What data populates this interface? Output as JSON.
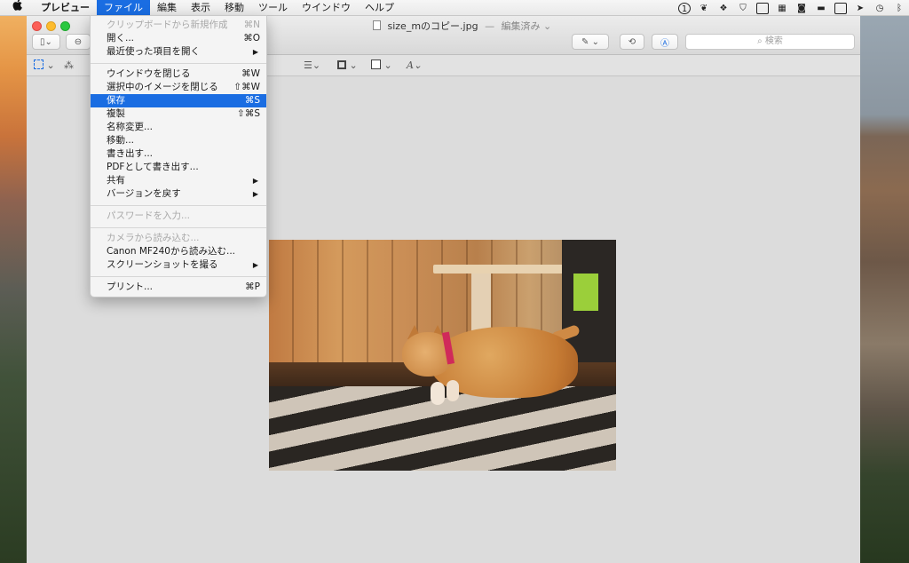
{
  "menubar": {
    "apple": "",
    "app_name": "プレビュー",
    "menus": [
      "ファイル",
      "編集",
      "表示",
      "移動",
      "ツール",
      "ウインドウ",
      "ヘルプ"
    ],
    "active_menu": "ファイル"
  },
  "status_icons": [
    "1password-icon",
    "evernote-icon",
    "dropbox-sync-icon",
    "shield-icon",
    "display-icon",
    "grid-icon",
    "camera-icon",
    "presentation-icon",
    "airplay-display-icon",
    "arrow-icon",
    "time-machine-icon",
    "bluetooth-icon"
  ],
  "window": {
    "filename": "size_mのコピー.jpg",
    "separator": "—",
    "status": "編集済み ⌄",
    "search_placeholder": "検索"
  },
  "file_menu": [
    {
      "label": "クリップボードから新規作成",
      "shortcut": "⌘N",
      "disabled": true
    },
    {
      "label": "開く...",
      "shortcut": "⌘O"
    },
    {
      "label": "最近使った項目を開く",
      "submenu": true
    },
    {
      "separator": true
    },
    {
      "label": "ウインドウを閉じる",
      "shortcut": "⌘W"
    },
    {
      "label": "選択中のイメージを閉じる",
      "shortcut": "⇧⌘W"
    },
    {
      "label": "保存",
      "shortcut": "⌘S",
      "highlighted": true
    },
    {
      "label": "複製",
      "shortcut": "⇧⌘S"
    },
    {
      "label": "名称変更..."
    },
    {
      "label": "移動..."
    },
    {
      "label": "書き出す..."
    },
    {
      "label": "PDFとして書き出す..."
    },
    {
      "label": "共有",
      "submenu": true
    },
    {
      "label": "バージョンを戻す",
      "submenu": true
    },
    {
      "separator": true
    },
    {
      "label": "パスワードを入力...",
      "disabled": true
    },
    {
      "separator": true
    },
    {
      "label": "カメラから読み込む...",
      "disabled": true
    },
    {
      "label": "Canon MF240から読み込む..."
    },
    {
      "label": "スクリーンショットを撮る",
      "submenu": true
    },
    {
      "separator": true
    },
    {
      "label": "プリント...",
      "shortcut": "⌘P"
    }
  ],
  "icons": {
    "submenu_arrow": "▶",
    "chevron": "⌄"
  },
  "colors": {
    "highlight": "#1a6de2",
    "window_bg": "#dcdcdc"
  }
}
